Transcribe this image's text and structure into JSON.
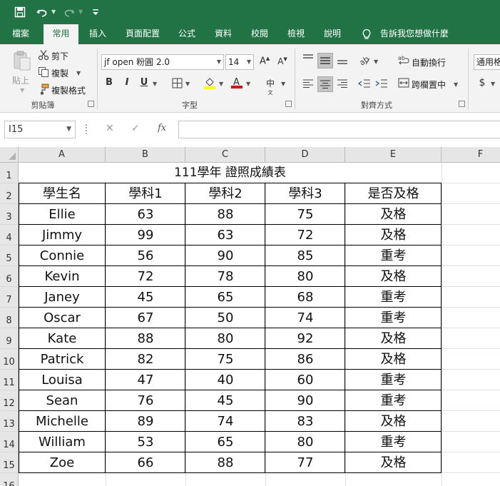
{
  "qat": {
    "save_icon": "save-icon",
    "undo_icon": "undo-icon",
    "redo_icon": "redo-icon",
    "customize_icon": "customize-qat-icon"
  },
  "tabs": [
    "檔案",
    "常用",
    "插入",
    "頁面配置",
    "公式",
    "資料",
    "校閱",
    "檢視",
    "說明"
  ],
  "active_tab": "常用",
  "tell_me": "告訴我您想做什麼",
  "ribbon": {
    "clipboard": {
      "paste": "貼上",
      "cut": "剪下",
      "copy": "複製",
      "format_painter": "複製格式",
      "label": "剪貼簿"
    },
    "font": {
      "font_name": "jf open 粉圓 2.0",
      "font_size": "14",
      "bold": "B",
      "italic": "I",
      "underline": "U",
      "label": "字型"
    },
    "alignment": {
      "wrap_text": "自動換行",
      "merge_center": "跨欄置中",
      "label": "對齊方式"
    },
    "number": {
      "format": "通用格",
      "currency": "$"
    }
  },
  "formula_bar": {
    "name_box": "I15",
    "fx": "fx",
    "formula": ""
  },
  "sheet": {
    "columns": [
      "A",
      "B",
      "C",
      "D",
      "E",
      "F"
    ],
    "rows": [
      "1",
      "2",
      "3",
      "4",
      "5",
      "6",
      "7",
      "8",
      "9",
      "10",
      "11",
      "12",
      "13",
      "14",
      "15",
      "16"
    ],
    "title": "111學年 證照成績表",
    "headers": [
      "學生名",
      "學科1",
      "學科2",
      "學科3",
      "是否及格"
    ],
    "data": [
      [
        "Ellie",
        "63",
        "88",
        "75",
        "及格"
      ],
      [
        "Jimmy",
        "99",
        "63",
        "72",
        "及格"
      ],
      [
        "Connie",
        "56",
        "90",
        "85",
        "重考"
      ],
      [
        "Kevin",
        "72",
        "78",
        "80",
        "及格"
      ],
      [
        "Janey",
        "45",
        "65",
        "68",
        "重考"
      ],
      [
        "Oscar",
        "67",
        "50",
        "74",
        "重考"
      ],
      [
        "Kate",
        "88",
        "80",
        "92",
        "及格"
      ],
      [
        "Patrick",
        "82",
        "75",
        "86",
        "及格"
      ],
      [
        "Louisa",
        "47",
        "40",
        "60",
        "重考"
      ],
      [
        "Sean",
        "76",
        "45",
        "90",
        "重考"
      ],
      [
        "Michelle",
        "89",
        "74",
        "83",
        "及格"
      ],
      [
        "William",
        "53",
        "65",
        "80",
        "重考"
      ],
      [
        "Zoe",
        "66",
        "88",
        "77",
        "及格"
      ]
    ]
  },
  "colors": {
    "excel_green": "#217346",
    "ribbon_bg": "#f3f3f3",
    "header_bg": "#e6e6e6"
  }
}
